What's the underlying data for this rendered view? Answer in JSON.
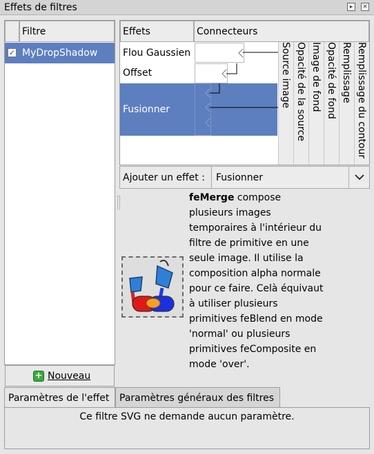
{
  "window": {
    "title": "Effets de filtres"
  },
  "filters": {
    "header": "Filtre",
    "items": [
      {
        "name": "MyDropShadow",
        "checked": true
      }
    ],
    "new_button": "Nouveau"
  },
  "effects": {
    "col_effects": "Effets",
    "col_connectors": "Connecteurs",
    "items": [
      {
        "label": "Flou Gaussien"
      },
      {
        "label": "Offset"
      },
      {
        "label": "Fusionner"
      }
    ],
    "inputs": [
      "Source image",
      "Opacité de la source",
      "Image de fond",
      "Opacité de fond",
      "Remplissage",
      "Remplissage du contour"
    ]
  },
  "add_effect": {
    "label": "Ajouter un effet :",
    "selected": "Fusionner"
  },
  "description": {
    "name": "feMerge",
    "text": " compose plusieurs images temporaires à l'intérieur du filtre de primitive en une seule image. Il utilise la composition alpha normale pour ce faire. Celà équivaut à utiliser plusieurs primitives feBlend en mode 'normal' ou plusieurs primitives feComposite en mode 'over'."
  },
  "tabs": [
    {
      "label": "Paramètres de l'effet",
      "active": true
    },
    {
      "label": "Paramètres généraux des filtres",
      "active": false
    }
  ],
  "params_message": "Ce filtre SVG ne demande aucun paramètre.",
  "colors": {
    "selection": "#5d7fbf",
    "add_icon": "#3bab3b"
  },
  "icons": {
    "effect_icon": "merge-buckets-icon",
    "new_icon": "plus-icon"
  }
}
